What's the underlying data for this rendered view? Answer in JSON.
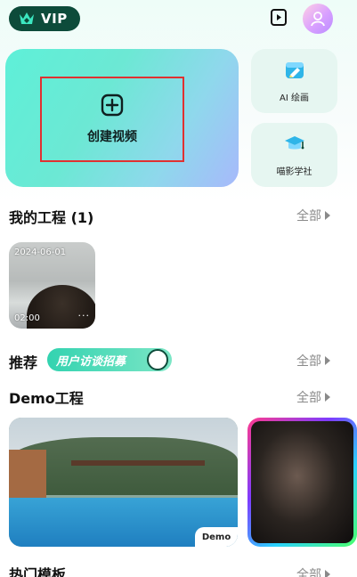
{
  "header": {
    "vip_label": "VIP",
    "accent_color": "#0d4b3a"
  },
  "create": {
    "label": "创建视频"
  },
  "side_cards": {
    "ai_label": "AI 绘画",
    "academy_label": "喵影学社"
  },
  "my_projects": {
    "title": "我的工程 (1)",
    "see_all": "全部",
    "items": [
      {
        "date": "2024-06-01",
        "duration": "02:00",
        "more": "···"
      }
    ]
  },
  "recommend": {
    "title": "推荐",
    "tag": "用户访谈招募",
    "see_all": "全部"
  },
  "demo": {
    "title": "Demo工程",
    "see_all": "全部",
    "tag": "Demo"
  },
  "hot_templates": {
    "title": "热门模板",
    "see_all": "全部"
  }
}
